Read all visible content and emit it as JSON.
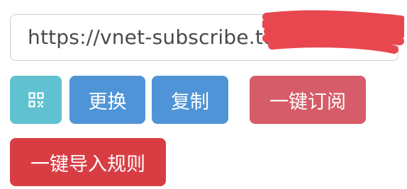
{
  "subscription": {
    "url_value": "https://vnet-subscribe.top/"
  },
  "buttons": {
    "qr_icon": "qr-code-icon",
    "change_label": "更换",
    "copy_label": "复制",
    "subscribe_label": "一键订阅",
    "import_rules_label": "一键导入规则"
  },
  "colors": {
    "qr_button": "#60c1d0",
    "primary_button": "#4f94d6",
    "subscribe_button": "#d55c68",
    "import_button": "#d93d44",
    "redaction": "#e8474f"
  }
}
